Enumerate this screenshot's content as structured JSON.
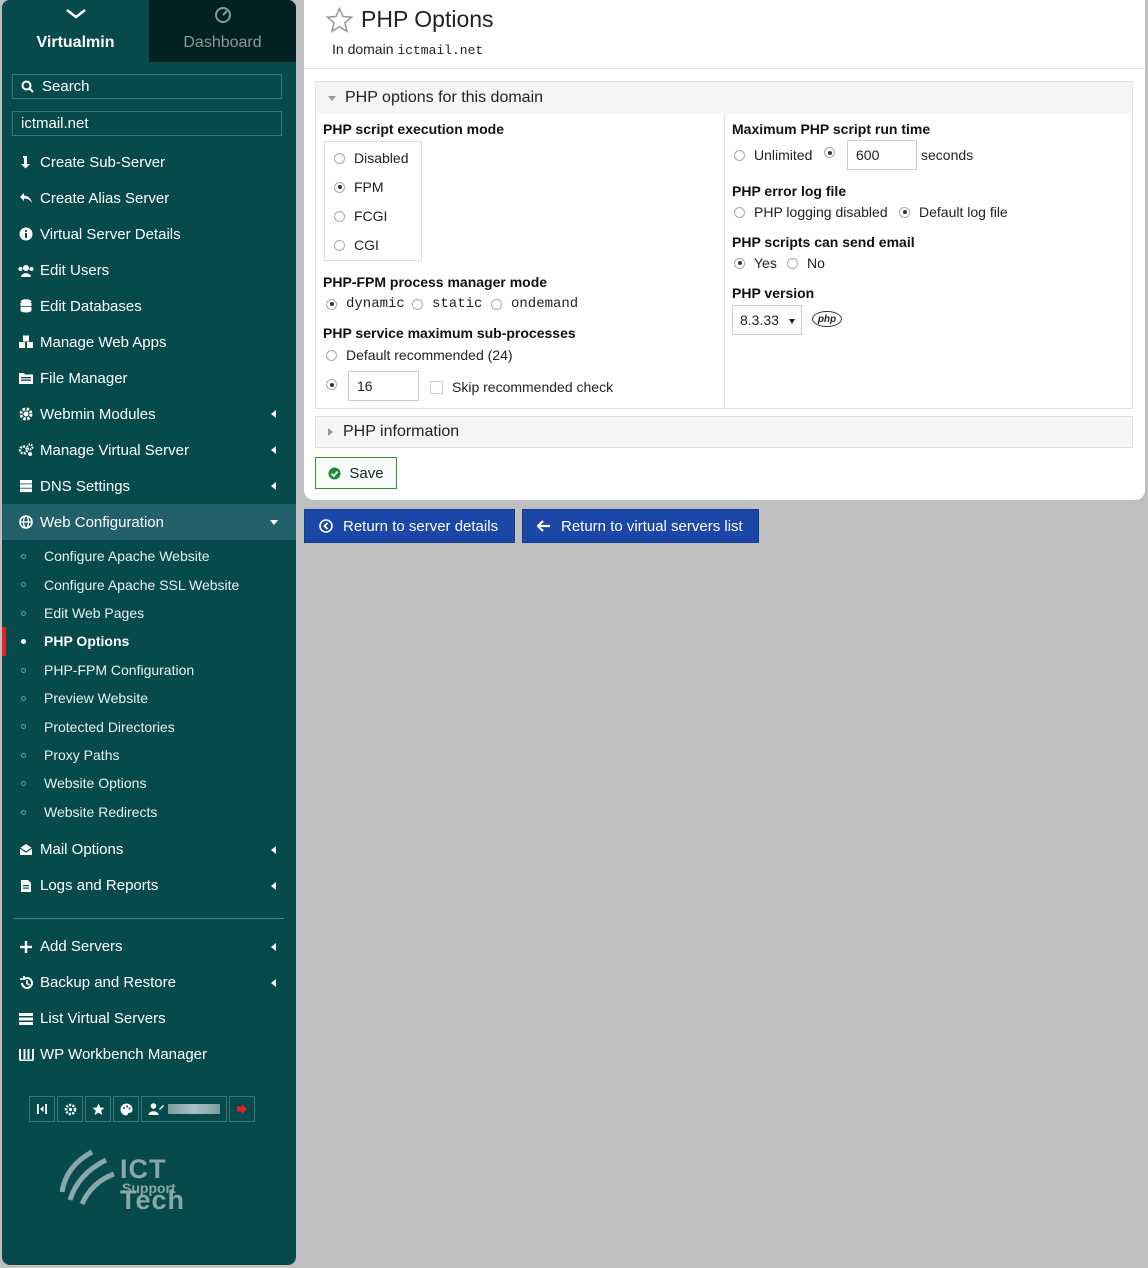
{
  "sidebar": {
    "tabs": [
      {
        "label": "Virtualmin",
        "icon": "virtualmin-chevron-icon",
        "active": true
      },
      {
        "label": "Dashboard",
        "icon": "dashboard-gauge-icon",
        "active": false
      }
    ],
    "search": {
      "placeholder": "Search",
      "icon": "search-icon"
    },
    "domain_select": {
      "value": "ictmail.net"
    },
    "menu": [
      {
        "label": "Create Sub-Server",
        "icon": "sub-server-arrow-icon"
      },
      {
        "label": "Create Alias Server",
        "icon": "reply-arrow-icon"
      },
      {
        "label": "Virtual Server Details",
        "icon": "info-circle-icon"
      },
      {
        "label": "Edit Users",
        "icon": "users-icon"
      },
      {
        "label": "Edit Databases",
        "icon": "database-icon"
      },
      {
        "label": "Manage Web Apps",
        "icon": "cubes-icon"
      },
      {
        "label": "File Manager",
        "icon": "file-manager-icon"
      },
      {
        "label": "Webmin Modules",
        "icon": "cogs-icon"
      },
      {
        "label": "Manage Virtual Server",
        "icon": "gears-icon"
      },
      {
        "label": "DNS Settings",
        "icon": "server-stack-icon"
      },
      {
        "label": "Web Configuration",
        "icon": "globe-icon"
      }
    ],
    "web_config_sub": [
      {
        "label": "Configure Apache Website",
        "active": false
      },
      {
        "label": "Configure Apache SSL Website",
        "active": false
      },
      {
        "label": "Edit Web Pages",
        "active": false
      },
      {
        "label": "PHP Options",
        "active": true
      },
      {
        "label": "PHP-FPM Configuration",
        "active": false
      },
      {
        "label": "Preview Website",
        "active": false
      },
      {
        "label": "Protected Directories",
        "active": false
      },
      {
        "label": "Proxy Paths",
        "active": false
      },
      {
        "label": "Website Options",
        "active": false
      },
      {
        "label": "Website Redirects",
        "active": false
      }
    ],
    "menu_after": [
      {
        "label": "Mail Options",
        "icon": "envelope-open-icon"
      },
      {
        "label": "Logs and Reports",
        "icon": "document-icon"
      }
    ],
    "menu_global": [
      {
        "label": "Add Servers",
        "icon": "plus-icon"
      },
      {
        "label": "Backup and Restore",
        "icon": "history-icon"
      },
      {
        "label": "List Virtual Servers",
        "icon": "list-icon"
      },
      {
        "label": "WP Workbench Manager",
        "icon": "wp-workbench-icon"
      }
    ],
    "bottom_icons": [
      "collapse-icon",
      "settings-gear-icon",
      "favorites-star-icon",
      "palette-icon",
      "user-icon",
      "logout-icon"
    ],
    "logo": {
      "line1": "ICT Tech",
      "line2": "Support"
    }
  },
  "page": {
    "title": "PHP Options",
    "subtitle_prefix": "In domain",
    "subtitle_domain": "ictmail.net"
  },
  "form": {
    "section_title": "PHP options for this domain",
    "exec_mode": {
      "label": "PHP script execution mode",
      "options": [
        "Disabled",
        "FPM",
        "FCGI",
        "CGI"
      ],
      "selected": "FPM"
    },
    "fpm_mode": {
      "label": "PHP-FPM process manager mode",
      "options": [
        "dynamic",
        "static",
        "ondemand"
      ],
      "selected": "dynamic"
    },
    "max_sub": {
      "label": "PHP service maximum sub-processes",
      "default_option": "Default recommended (24)",
      "value": "16",
      "skip_label": "Skip recommended check"
    },
    "max_runtime": {
      "label": "Maximum PHP script run time",
      "unlimited": "Unlimited",
      "value": "600",
      "unit": "seconds"
    },
    "error_log": {
      "label": "PHP error log file",
      "options": [
        "PHP logging disabled",
        "Default log file"
      ],
      "selected": "Default log file"
    },
    "send_email": {
      "label": "PHP scripts can send email",
      "options": [
        "Yes",
        "No"
      ],
      "selected": "Yes"
    },
    "version": {
      "label": "PHP version",
      "value": "8.3.33",
      "logo_text": "php"
    },
    "info_section_title": "PHP information",
    "save_label": "Save"
  },
  "actions": {
    "return_details": "Return to server details",
    "return_list": "Return to virtual servers list"
  }
}
